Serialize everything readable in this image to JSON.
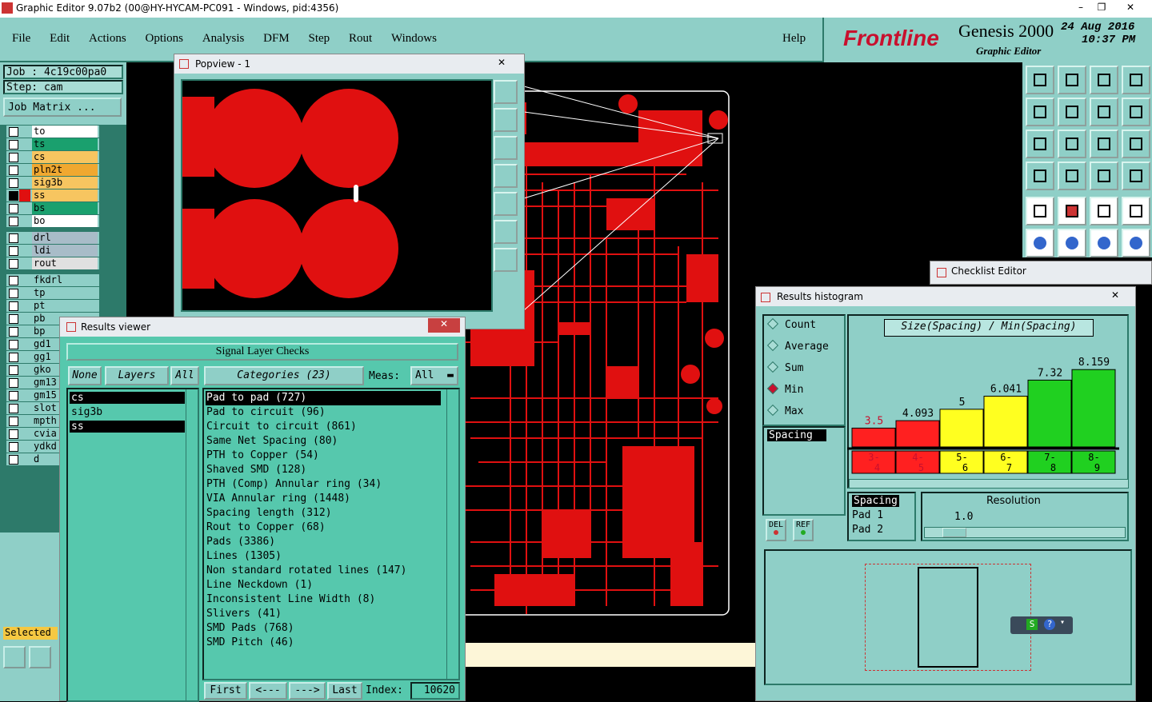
{
  "window": {
    "title": "Graphic Editor 9.07b2 (00@HY-HYCAM-PC091 - Windows, pid:4356)"
  },
  "menu": {
    "items": [
      "File",
      "Edit",
      "Actions",
      "Options",
      "Analysis",
      "DFM",
      "Step",
      "Rout",
      "Windows"
    ],
    "help": "Help"
  },
  "brand": {
    "logo": "Frontline",
    "product": "Genesis 2000",
    "subtitle": "Graphic Editor",
    "date": "24 Aug 2016",
    "time": "10:37 PM"
  },
  "job": {
    "job": "Job  : 4c19c00pa0",
    "step": "Step: cam",
    "matrix": "Job Matrix ..."
  },
  "layers": [
    "to",
    "ts",
    "cs",
    "pln2t",
    "sig3b",
    "ss",
    "bs",
    "bo",
    "drl",
    "ldi",
    "rout",
    "fkdrl",
    "tp",
    "pt",
    "pb",
    "bp",
    "gd1",
    "gg1",
    "gko",
    "gm13",
    "gm15",
    "slot",
    "mpth",
    "cvia",
    "ydkd",
    "d"
  ],
  "selected_label": "Selected",
  "popview": {
    "title": "Popview - 1"
  },
  "results_viewer": {
    "title": "Results viewer",
    "header": "Signal Layer Checks",
    "none": "None",
    "layers": "Layers",
    "all": "All",
    "categories_label": "Categories (23)",
    "meas_label": "Meas:",
    "meas_value": "All",
    "layer_list": [
      "cs",
      "sig3b",
      "ss"
    ],
    "categories": [
      "Pad to pad (727)",
      "Pad to circuit (96)",
      "Circuit to circuit (861)",
      "Same Net Spacing (80)",
      "PTH to Copper (54)",
      "Shaved SMD (128)",
      "PTH (Comp) Annular ring (34)",
      "VIA Annular ring (1448)",
      "Spacing length (312)",
      "Rout to Copper (68)",
      "Pads (3386)",
      "Lines (1305)",
      "Non standard rotated lines (147)",
      "Line Neckdown (1)",
      "Inconsistent Line Width (8)",
      "Slivers (41)",
      "SMD Pads (768)",
      "SMD Pitch (46)"
    ],
    "nav": {
      "first": "First",
      "prev": "<---",
      "next": "--->",
      "last": "Last",
      "index_label": "Index:",
      "index_value": "10620"
    }
  },
  "checklist": {
    "title": "Checklist Editor"
  },
  "histogram": {
    "title": "Results histogram",
    "options": [
      "Count",
      "Average",
      "Sum",
      "Min",
      "Max"
    ],
    "selected_option": "Min",
    "list_item": "Spacing",
    "del": "DEL",
    "ref": "REF",
    "chart_title": "Size(Spacing) / Min(Spacing)",
    "resolution_label": "Resolution",
    "resolution_value": "1.0",
    "attrs": [
      "Spacing",
      "Pad 1",
      "Pad 2"
    ]
  },
  "chart_data": {
    "type": "bar",
    "title": "Size(Spacing) / Min(Spacing)",
    "categories": [
      "3-4",
      "4-5",
      "5-6",
      "6-7",
      "7-8",
      "8-9"
    ],
    "values": [
      3.5,
      4.093,
      5,
      6.041,
      7.32,
      8.159
    ],
    "value_labels": [
      "3.5",
      "4.093",
      "5",
      "6.041",
      "7.32",
      "8.159"
    ],
    "colors": [
      "#ff2020",
      "#ff2020",
      "#ffff20",
      "#ffff20",
      "#20d020",
      "#20d020"
    ],
    "ylim": [
      0,
      9
    ]
  }
}
